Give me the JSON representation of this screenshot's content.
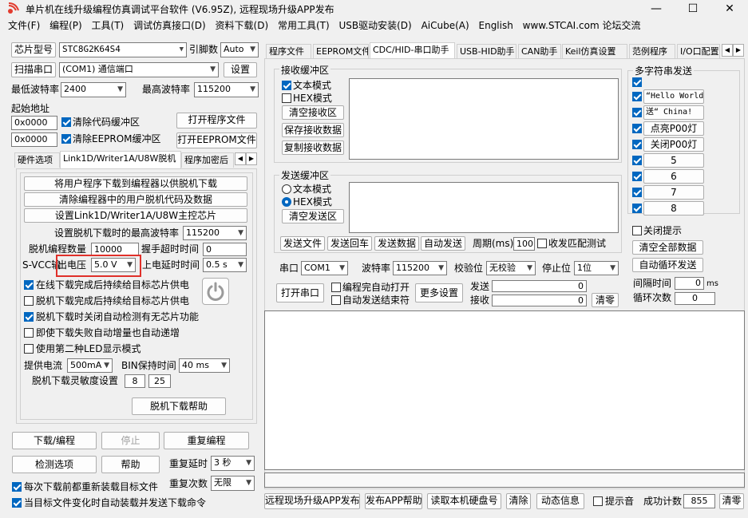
{
  "title": "单片机在线升级编程仿真调试平台软件 (V6.95Z), 远程现场升级APP发布",
  "window_controls": {
    "minimize": "—",
    "maximize": "☐",
    "close": "✕"
  },
  "menu": [
    "文件(F)",
    "编程(P)",
    "工具(T)",
    "调试仿真接口(D)",
    "资料下载(D)",
    "常用工具(T)",
    "USB驱动安装(D)",
    "AiCube(A)",
    "English",
    "www.STCAI.com 论坛交流"
  ],
  "left": {
    "chip_model_btn": "芯片型号",
    "chip_model": "STC8G2K64S4",
    "pin_label": "引脚数",
    "pin_value": "Auto",
    "scan_port_btn": "扫描串口",
    "port_value": "(COM1) 通信端口",
    "settings_btn": "设置",
    "min_baud_label": "最低波特率",
    "min_baud": "2400",
    "max_baud_label": "最高波特率",
    "max_baud": "115200",
    "start_addr_label": "起始地址",
    "addr1": "0x0000",
    "clear_code_label": "清除代码缓冲区",
    "open_prog_btn": "打开程序文件",
    "addr2": "0x0000",
    "clear_eeprom_label": "清除EEPROM缓冲区",
    "open_eeprom_btn": "打开EEPROM文件",
    "tabs": [
      "硬件选项",
      "Link1D/Writer1A/U8W脱机",
      "程序加密后"
    ],
    "offline": {
      "btn1": "将用户程序下载到编程器以供脱机下载",
      "btn2": "清除编程器中的用户脱机代码及数据",
      "btn3": "设置Link1D/Writer1A/U8W主控芯片",
      "max_baud_label": "设置脱机下载时的最高波特率",
      "max_baud": "115200",
      "count_label": "脱机编程数量",
      "count": "10000",
      "handshake_label": "握手超时时间",
      "handshake": "0",
      "svcc_label": "S-VCC输",
      "out_voltage_label": "出电压",
      "out_voltage": "5.0 V",
      "power_delay_label": "上电延时时间",
      "power_delay": "0.5 s",
      "chk1": "在线下载完成后持续给目标芯片供电",
      "chk2": "脱机下载完成后持续给目标芯片供电",
      "chk3": "脱机下载时关闭自动检测有无芯片功能",
      "chk4": "即使下载失败自动增量也自动递增",
      "chk5": "使用第二种LED显示模式",
      "current_label": "提供电流",
      "current": "500mA",
      "bin_hold_label": "BIN保持时间",
      "bin_hold": "40 ms",
      "sensitivity_label": "脱机下载灵敏度设置",
      "sens1": "8",
      "sens2": "25",
      "help_btn": "脱机下载帮助"
    },
    "download_btn": "下载/编程",
    "stop_btn": "停止",
    "reprogram_btn": "重复编程",
    "check_btn": "检测选项",
    "help_btn": "帮助",
    "repeat_delay_label": "重复延时",
    "repeat_delay": "3 秒",
    "repeat_count_label": "重复次数",
    "repeat_count": "无限",
    "reload_label": "每次下载前都重新装载目标文件",
    "auto_label": "当目标文件变化时自动装载并发送下载命令"
  },
  "right": {
    "tabs": [
      "程序文件",
      "EEPROM文件",
      "CDC/HID-串口助手",
      "USB-HID助手",
      "CAN助手",
      "Keil仿真设置",
      "范例程序",
      "I/O口配置"
    ],
    "recv": {
      "title": "接收缓冲区",
      "text_mode": "文本模式",
      "hex_mode": "HEX模式",
      "clear_btn": "清空接收区",
      "save_btn": "保存接收数据",
      "copy_btn": "复制接收数据"
    },
    "send": {
      "title": "发送缓冲区",
      "text_mode": "文本模式",
      "hex_mode": "HEX模式",
      "clear_btn": "清空发送区",
      "send_file_btn": "发送文件",
      "send_enter_btn": "发送回车",
      "send_data_btn": "发送数据",
      "auto_send_btn": "自动发送",
      "period_label": "周期(ms)",
      "period": "100",
      "match_label": "收发匹配测试"
    },
    "serial": {
      "port_label": "串口",
      "port": "COM1",
      "baud_label": "波特率",
      "baud": "115200",
      "parity_label": "校验位",
      "parity": "无校验",
      "stop_label": "停止位",
      "stop": "1位",
      "open_btn": "打开串口",
      "auto_open_label": "编程完自动打开",
      "auto_end_label": "自动发送结束符",
      "more_btn": "更多设置",
      "send_label": "发送",
      "send_count": "0",
      "recv_label": "接收",
      "recv_count": "0",
      "clear_btn": "清零"
    },
    "multi": {
      "title": "多字符串发送",
      "items": [
        "“Hello World”",
        "送“ China!",
        "点亮P00灯",
        "关闭P00灯",
        "5",
        "6",
        "7",
        "8"
      ],
      "close_hint_label": "关闭提示",
      "clear_all_btn": "清空全部数据",
      "auto_loop_btn": "自动循环发送",
      "interval_label": "间隔时间",
      "interval": "0",
      "interval_unit": "ms",
      "loop_count_label": "循环次数",
      "loop_count": "0"
    },
    "bottom": {
      "publish_btn": "远程现场升级APP发布",
      "publish_help_btn": "发布APP帮助",
      "read_disk_btn": "读取本机硬盘号",
      "clear_btn": "清除",
      "anim_btn": "动态信息",
      "sound_label": "提示音",
      "success_label": "成功计数",
      "success_count": "855",
      "reset_btn": "清零"
    }
  }
}
